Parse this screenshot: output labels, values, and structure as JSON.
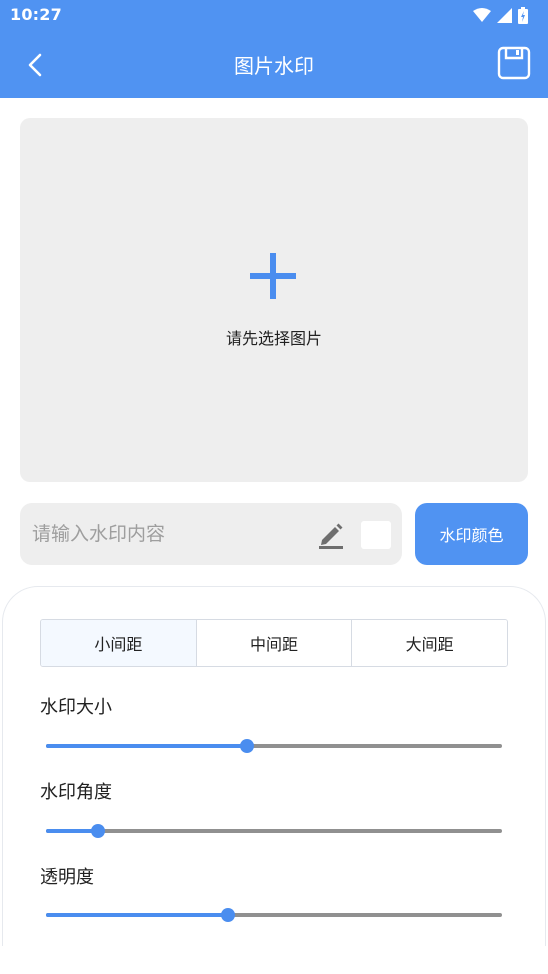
{
  "status_bar": {
    "time": "10:27"
  },
  "app_bar": {
    "title": "图片水印"
  },
  "image_picker": {
    "hint": "请先选择图片"
  },
  "watermark_input": {
    "placeholder": "请输入水印内容",
    "value": ""
  },
  "color_button": {
    "label": "水印颜色"
  },
  "swatch_color": "#ffffff",
  "spacing": {
    "options": [
      "小间距",
      "中间距",
      "大间距"
    ],
    "selected": "小间距"
  },
  "sliders": [
    {
      "label": "水印大小",
      "value": 0.44
    },
    {
      "label": "水印角度",
      "value": 0.115
    },
    {
      "label": "透明度",
      "value": 0.4
    }
  ],
  "colors": {
    "primary": "#5093f2",
    "accent": "#4a8def",
    "surface": "#eeeeee"
  },
  "icons": [
    "wifi-icon",
    "signal-icon",
    "battery-icon",
    "back-arrow-icon",
    "save-icon",
    "plus-icon",
    "edit-icon"
  ]
}
